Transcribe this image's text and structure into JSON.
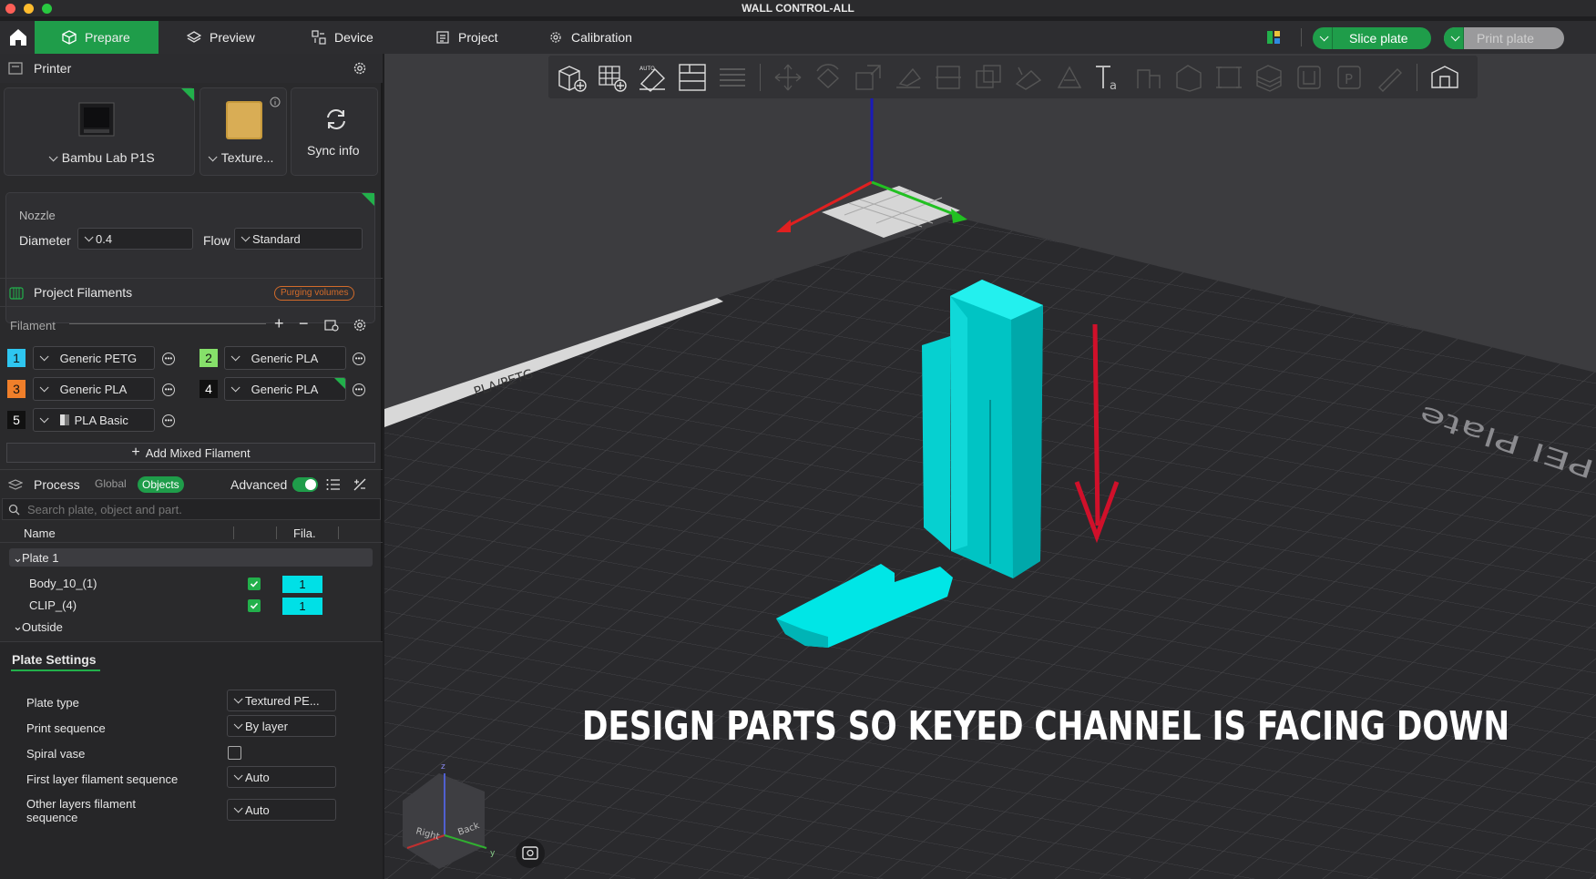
{
  "window": {
    "title": "WALL CONTROL-ALL"
  },
  "colors": {
    "accent": "#1f9d4a",
    "corner": "#22b04b",
    "part": "#00e6e6",
    "arrow": "#d0102a"
  },
  "menu": {
    "tabs": [
      {
        "label": "Prepare",
        "icon": "cube-icon"
      },
      {
        "label": "Preview",
        "icon": "layers-icon"
      },
      {
        "label": "Device",
        "icon": "device-icon"
      },
      {
        "label": "Project",
        "icon": "project-icon"
      },
      {
        "label": "Calibration",
        "icon": "calibration-icon"
      }
    ],
    "slice_label": "Slice plate",
    "print_label": "Print plate"
  },
  "printer": {
    "header": "Printer",
    "model": "Bambu Lab P1S",
    "plate": "Texture...",
    "sync": "Sync info"
  },
  "nozzle": {
    "title": "Nozzle",
    "diameter_label": "Diameter",
    "diameter_value": "0.4",
    "flow_label": "Flow",
    "flow_value": "Standard"
  },
  "filaments": {
    "header": "Project Filaments",
    "purge_label": "Purging volumes",
    "filament_label": "Filament",
    "items": [
      {
        "num": "1",
        "name": "Generic PETG",
        "color": "#2ec6f0"
      },
      {
        "num": "2",
        "name": "Generic PLA",
        "color": "#86e06a"
      },
      {
        "num": "3",
        "name": "Generic PLA",
        "color": "#f07f2a"
      },
      {
        "num": "4",
        "name": "Generic PLA",
        "color": "#111111"
      },
      {
        "num": "5",
        "name": "PLA Basic",
        "color": "#111111"
      }
    ],
    "add_mixed": "Add Mixed Filament"
  },
  "process": {
    "header": "Process",
    "global_label": "Global",
    "objects_label": "Objects",
    "advanced_label": "Advanced",
    "search_placeholder": "Search plate, object and part."
  },
  "objects": {
    "col_name": "Name",
    "col_fila": "Fila.",
    "plate": "Plate 1",
    "rows": [
      {
        "name": "Body_10_(1)",
        "fila": "1"
      },
      {
        "name": "CLIP_(4)",
        "fila": "1"
      }
    ],
    "outside": "Outside"
  },
  "plate_settings": {
    "title": "Plate Settings",
    "rows": [
      {
        "label": "Plate type",
        "value": "Textured PE..."
      },
      {
        "label": "Print sequence",
        "value": "By layer"
      },
      {
        "label": "Spiral vase",
        "value": ""
      },
      {
        "label": "First layer filament sequence",
        "value": "Auto"
      },
      {
        "label": "Other layers filament sequence",
        "value": "Auto"
      }
    ]
  },
  "viewport": {
    "bed_text": "PEI Plate",
    "bed_strip": "PLA/PETG",
    "caption": "DESIGN PARTS SO KEYED CHANNEL IS FACING DOWN",
    "axes": {
      "right": "Right",
      "back": "Back",
      "z": "z",
      "y": "y"
    }
  }
}
